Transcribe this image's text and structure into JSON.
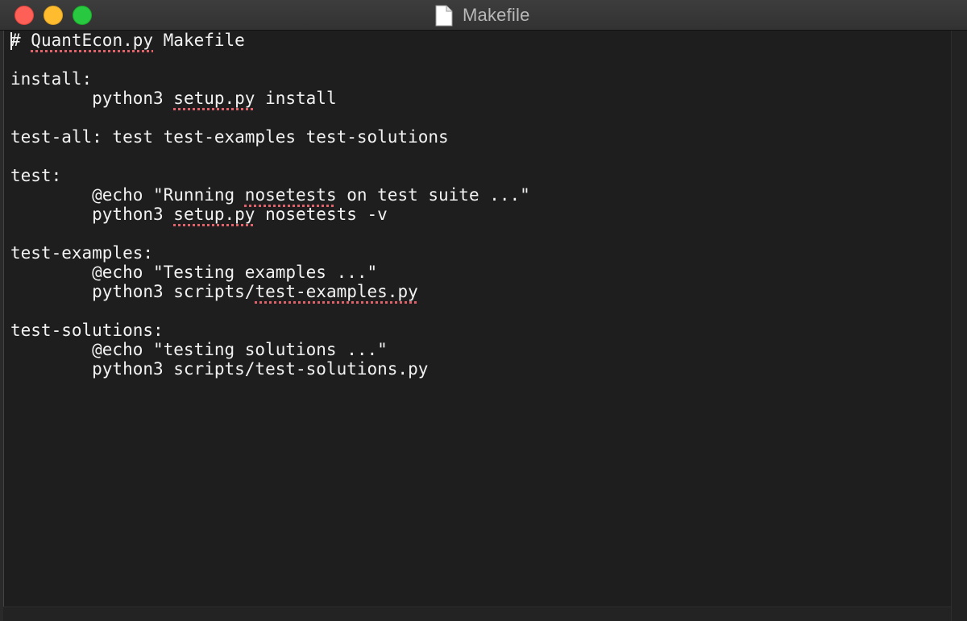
{
  "window": {
    "title": "Makefile",
    "buttons": {
      "close": "close",
      "minimize": "minimize",
      "zoom": "zoom"
    },
    "icons": {
      "document": "document-icon"
    }
  },
  "editor": {
    "lines": [
      {
        "text": "# QuantEcon.py Makefile"
      },
      {
        "text": ""
      },
      {
        "text": "install:"
      },
      {
        "text": "        python3 setup.py install"
      },
      {
        "text": ""
      },
      {
        "text": "test-all: test test-examples test-solutions"
      },
      {
        "text": ""
      },
      {
        "text": "test:"
      },
      {
        "text": "        @echo \"Running nosetests on test suite ...\""
      },
      {
        "text": "        python3 setup.py nosetests -v"
      },
      {
        "text": ""
      },
      {
        "text": "test-examples:"
      },
      {
        "text": "        @echo \"Testing examples ...\""
      },
      {
        "text": "        python3 scripts/test-examples.py"
      },
      {
        "text": ""
      },
      {
        "text": "test-solutions:"
      },
      {
        "text": "        @echo \"testing solutions ...\""
      },
      {
        "text": "        python3 scripts/test-solutions.py"
      }
    ],
    "spellcheck_flagged": [
      "QuantEcon.py",
      "setup.py",
      "nosetests",
      "setup.py",
      "test-examples.py"
    ],
    "colors": {
      "background": "#1e1e1e",
      "text": "#f2f2f2",
      "spellcheck_underline": "#e0636b"
    }
  }
}
